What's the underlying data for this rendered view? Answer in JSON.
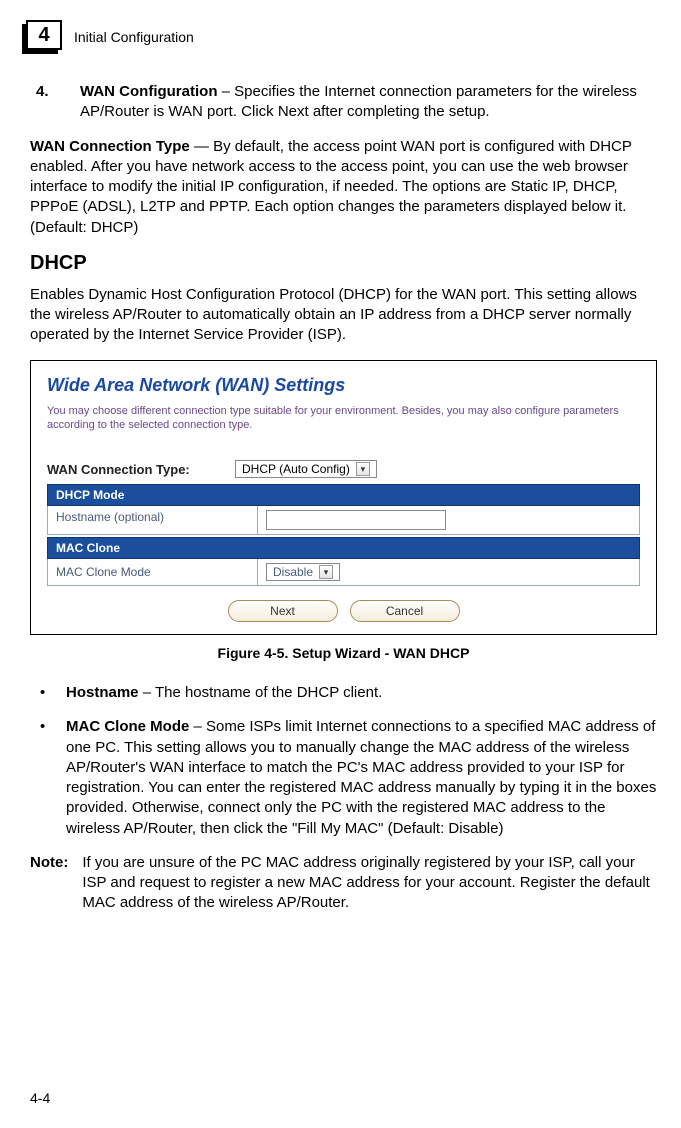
{
  "header": {
    "chapter_number": "4",
    "chapter_title": "Initial Configuration"
  },
  "para1": {
    "num": "4.",
    "bold": "WAN Configuration",
    "rest": " – Specifies the Internet connection parameters for the wireless AP/Router is WAN port. Click Next after completing the setup."
  },
  "para2": {
    "bold": "WAN Connection Type",
    "rest": " — By default, the access point WAN port is configured with DHCP enabled. After you have network access to the access point, you can use the web browser interface to modify the initial IP configuration, if needed. The options are Static IP, DHCP, PPPoE (ADSL), L2TP and PPTP. Each option changes the parameters displayed below it. (Default: DHCP)"
  },
  "dhcp_heading": "DHCP",
  "para3": "Enables Dynamic Host Configuration Protocol (DHCP) for the WAN port. This setting allows the wireless AP/Router to automatically obtain an IP address from a DHCP server normally operated by the Internet Service Provider (ISP).",
  "figure": {
    "title": "Wide Area Network (WAN) Settings",
    "subtitle": "You may choose different connection type suitable for your environment. Besides, you may also configure parameters according to the selected connection type.",
    "wan_label": "WAN Connection Type:",
    "wan_value": "DHCP (Auto Config)",
    "bar_dhcp": "DHCP Mode",
    "hostname_label": "Hostname (optional)",
    "bar_mac": "MAC Clone",
    "macclone_label": "MAC Clone Mode",
    "macclone_value": "Disable",
    "btn_next": "Next",
    "btn_cancel": "Cancel"
  },
  "caption": "Figure 4-5.   Setup Wizard - WAN DHCP",
  "bullet1": {
    "bold": "Hostname",
    "rest": " – The hostname of the DHCP client."
  },
  "bullet2": {
    "bold": "MAC Clone Mode",
    "rest": " – Some ISPs limit Internet connections to a specified MAC address of one PC. This setting allows you to manually change the MAC address of the wireless AP/Router's WAN interface to match the PC's MAC address provided to your ISP for registration. You can enter the registered MAC address manually by typing it in the boxes provided. Otherwise, connect only the PC with the registered MAC address to the wireless AP/Router, then click the \"Fill My MAC\" (Default: Disable)"
  },
  "note": {
    "label": "Note:",
    "text": "If you are unsure of the PC MAC address originally registered by your ISP, call your ISP and request to register a new MAC address for your account. Register the default MAC address of the wireless AP/Router."
  },
  "page_number": "4-4"
}
